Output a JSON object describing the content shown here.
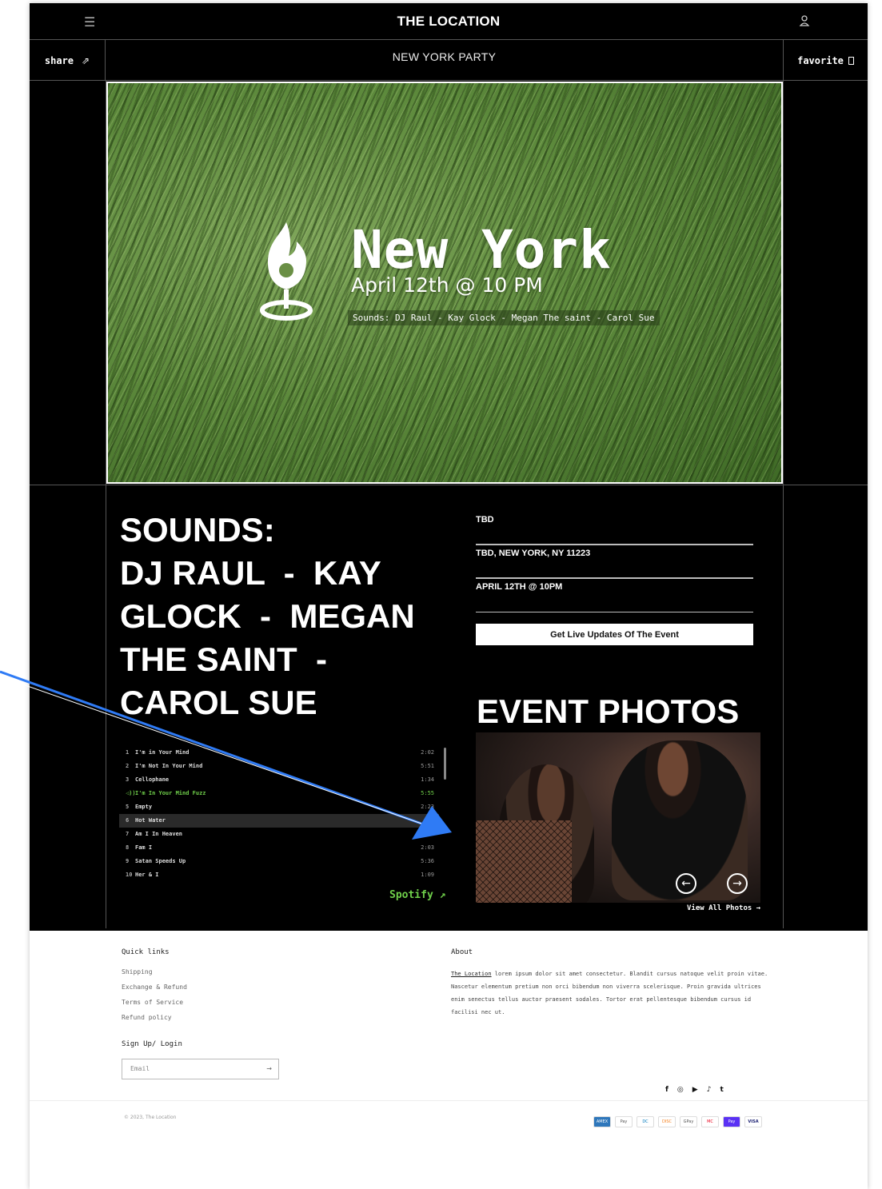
{
  "header": {
    "title": "THE LOCATION",
    "menu_icon": "hamburger-icon",
    "account_icon": "user-icon"
  },
  "subbar": {
    "share_label": "share",
    "subtitle": "NEW YORK PARTY",
    "favorite_label": "favorite"
  },
  "hero": {
    "city": "New York",
    "date": "April 12th @ 10 PM",
    "lineup": "Sounds: DJ Raul - Kay Glock - Megan The saint - Carol Sue"
  },
  "sounds": {
    "lines": [
      "SOUNDS:",
      "DJ RAUL  -  KAY",
      "GLOCK  -  MEGAN",
      "THE SAINT  -",
      "CAROL SUE"
    ]
  },
  "info": {
    "venue": "TBD",
    "address": "TBD, NEW YORK, NY 11223",
    "datetime": "APRIL 12TH @ 10PM",
    "updates_button": "Get Live Updates Of The Event"
  },
  "photos": {
    "title": "EVENT PHOTOS",
    "view_all": "View All Photos  →"
  },
  "tracks": [
    {
      "num": "1",
      "title": "I'm in Your Mind",
      "dur": "2:02"
    },
    {
      "num": "2",
      "title": "I'm Not In Your Mind",
      "dur": "5:51"
    },
    {
      "num": "3",
      "title": "Cellophane",
      "dur": "1:34"
    },
    {
      "num": "◁))",
      "title": "I'm In Your Mind Fuzz",
      "dur": "5:55"
    },
    {
      "num": "5",
      "title": "Empty",
      "dur": "2:23"
    },
    {
      "num": "6",
      "title": "Hot Water",
      "dur": ""
    },
    {
      "num": "7",
      "title": "Am I In Heaven",
      "dur": ""
    },
    {
      "num": "8",
      "title": "Fam I",
      "dur": "2:03"
    },
    {
      "num": "9",
      "title": "Satan Speeds Up",
      "dur": "5:36"
    },
    {
      "num": "10",
      "title": "Her & I",
      "dur": "1:09"
    }
  ],
  "spotify_label": "Spotify ↗",
  "footer": {
    "quick_links_title": "Quick links",
    "links": [
      "Shipping",
      "Exchange & Refund",
      "Terms of Service",
      "Refund policy"
    ],
    "signup_title": "Sign Up/ Login",
    "email_placeholder": "Email",
    "about_title": "About",
    "about_link": "The Location",
    "about_text": " lorem ipsum dolor sit amet consectetur. Blandit cursus natoque velit proin vitae. Nascetur elementum pretium non orci bibendum non viverra scelerisque. Proin gravida ultrices enim senectus tellus auctor praesent sodales. Tortor erat pellentesque bibendum cursus id facilisi nec ut.",
    "copyright": "© 2023, The Location",
    "social": [
      "f",
      "◎",
      "▶",
      "♪",
      "t"
    ],
    "payments": [
      "AMEX",
      "Pay",
      "DC",
      "DISC",
      "GPay",
      "MC",
      "Pay",
      "VISA"
    ]
  },
  "colors": {
    "accent_green": "#6fcf4a",
    "annotation_arrow": "#2f7bf5"
  }
}
